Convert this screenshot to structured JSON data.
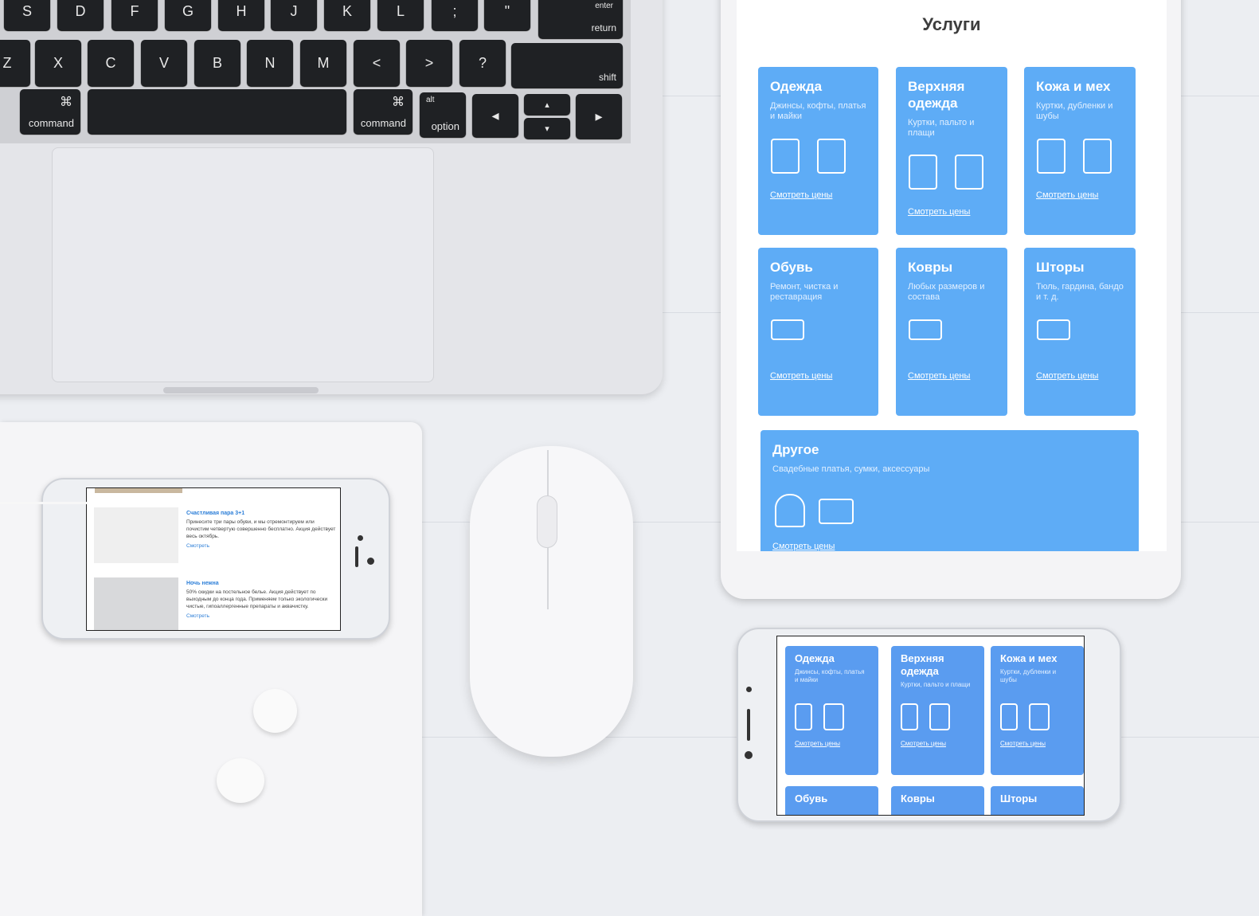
{
  "keyboard": {
    "row1": [
      "S",
      "D",
      "F",
      "G",
      "H",
      "J",
      "K",
      "L",
      ";",
      "\""
    ],
    "enter_top": "enter",
    "enter_bottom": "return",
    "row2": [
      "Z",
      "X",
      "C",
      "V",
      "B",
      "N",
      "M",
      "<",
      ">",
      "?"
    ],
    "shift": "shift",
    "command_symbol": "⌘",
    "command": "command",
    "alt": "alt",
    "option": "option",
    "arrows": [
      "◂",
      "▴",
      "▾",
      "▸"
    ]
  },
  "tablet": {
    "title": "Услуги",
    "cards": [
      {
        "title": "Одежда",
        "desc": "Джинсы, кофты, платья и майки",
        "link": "Смотреть цены",
        "icons": [
          "jeans-icon",
          "dress-icon"
        ]
      },
      {
        "title": "Верхняя одежда",
        "desc": "Куртки, пальто и плащи",
        "link": "Смотреть цены",
        "icons": [
          "jacket-icon",
          "coat-icon"
        ]
      },
      {
        "title": "Кожа и мех",
        "desc": "Куртки, дубленки и шубы",
        "link": "Смотреть цены",
        "icons": [
          "sheepskin-icon",
          "fur-coat-icon"
        ]
      },
      {
        "title": "Обувь",
        "desc": "Ремонт, чистка и реставрация",
        "link": "Смотреть цены",
        "icons": [
          "sneaker-icon"
        ]
      },
      {
        "title": "Ковры",
        "desc": "Любых размеров и состава",
        "link": "Смотреть цены",
        "icons": [
          "carpet-icon"
        ]
      },
      {
        "title": "Шторы",
        "desc": "Тюль, гардина, бандо и т. д.",
        "link": "Смотреть цены",
        "icons": [
          "curtains-icon"
        ]
      }
    ],
    "other": {
      "title": "Другое",
      "desc": "Свадебные платья, сумки, аксессуары",
      "link": "Смотреть цены",
      "icons": [
        "hat-icon",
        "bag-icon"
      ]
    }
  },
  "phone_small": {
    "promos": [
      {
        "title": "Счастливая пара 3+1",
        "text": "Принесите три пары обуви, и мы отремонтируем или почистим четвертую совершенно бесплатно. Акция действует весь октябрь.",
        "link": "Смотреть"
      },
      {
        "title": "Ночь нежна",
        "text": "50% скидки на постельное белье. Акция действует по выходным до конца года. Применяем только экологически чистые, гипоаллергенные препараты и аквачистку.",
        "link": "Смотреть"
      }
    ]
  },
  "phone_large": {
    "cards": [
      {
        "title": "Одежда",
        "desc": "Джинсы, кофты, платья и майки",
        "link": "Смотреть цены"
      },
      {
        "title": "Верхняя одежда",
        "desc": "Куртки, пальто и плащи",
        "link": "Смотреть цены"
      },
      {
        "title": "Кожа и мех",
        "desc": "Куртки, дубленки и шубы",
        "link": "Смотреть цены"
      },
      {
        "title": "Обувь"
      },
      {
        "title": "Ковры"
      },
      {
        "title": "Шторы"
      }
    ]
  },
  "colors": {
    "card_blue": "#5eacf6",
    "link_blue": "#2d7fd8"
  }
}
